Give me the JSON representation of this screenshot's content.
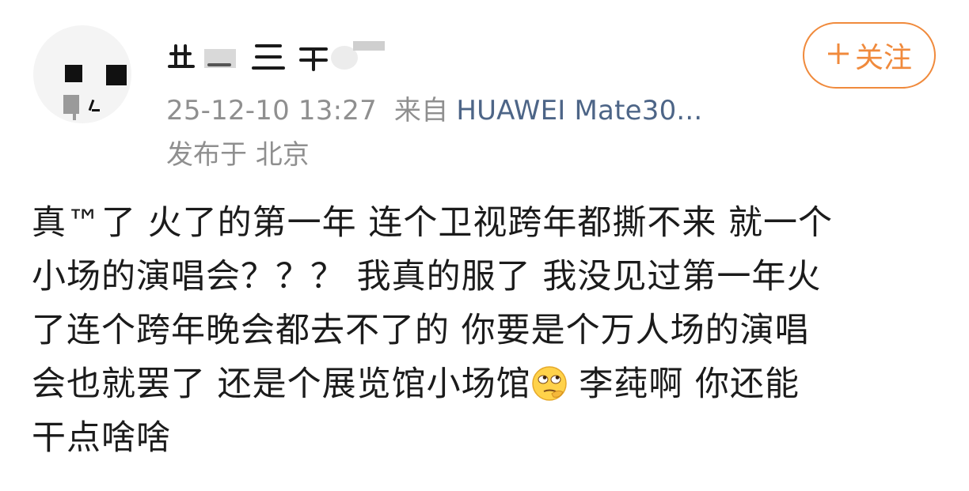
{
  "post": {
    "author": {
      "avatar_icon": "avatar-icon",
      "username_obscured": true
    },
    "timestamp": "25-12-10 13:27",
    "source_prefix": "来自",
    "device": "HUAWEI Mate30...",
    "location": "发布于 北京",
    "follow_button": {
      "label": "关注",
      "icon": "plus-icon",
      "color": "#f08a3c"
    },
    "content_lines": [
      "真™了  火了的第一年 连个卫视跨年都撕不来  就一个",
      "小场的演唱会？？？   我真的服了  我没见过第一年火",
      "了连个跨年晚会都去不了的  你要是个万人场的演唱",
      "会也就罢了  还是个展览馆小场馆",
      "干点啥啥"
    ],
    "content_line4_tail": "  李莼啊  你还能",
    "emoji_icon": "rolling-eyes-emoji-icon"
  }
}
